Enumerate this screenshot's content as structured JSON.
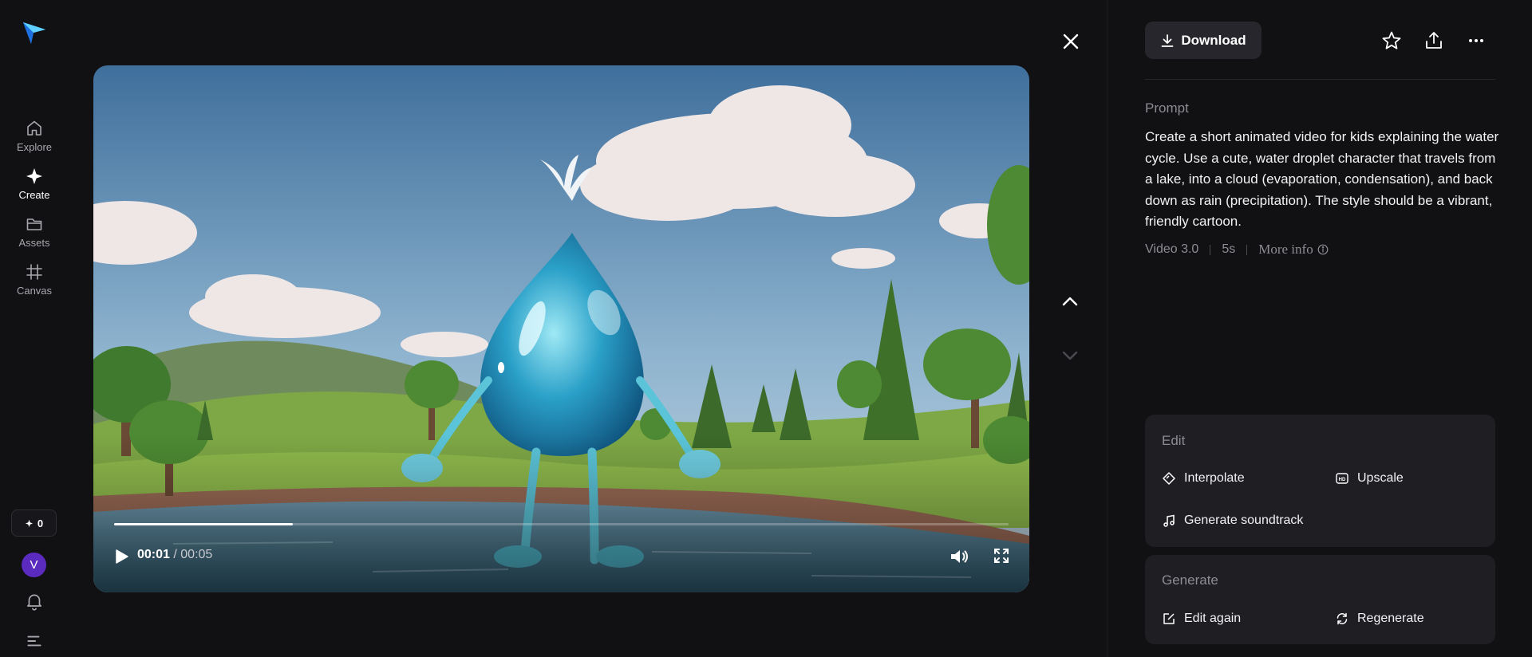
{
  "nav": {
    "items": [
      {
        "label": "Explore",
        "icon": "home-icon"
      },
      {
        "label": "Create",
        "icon": "sparkle-icon",
        "active": true
      },
      {
        "label": "Assets",
        "icon": "folder-icon"
      },
      {
        "label": "Canvas",
        "icon": "canvas-icon"
      }
    ],
    "credits": "0",
    "avatar_initial": "V"
  },
  "player": {
    "current_time": "00:01",
    "duration": "/ 00:05",
    "progress": 0.2
  },
  "header": {
    "download_label": "Download"
  },
  "prompt": {
    "title": "Prompt",
    "text": "Create a short animated video for kids explaining the water cycle. Use a cute, water droplet character that travels from a lake, into a cloud (evaporation, condensation), and back down as rain (precipitation). The style should be a vibrant, friendly cartoon.",
    "model": "Video 3.0",
    "length": "5s",
    "more_info": "More info"
  },
  "edit": {
    "title": "Edit",
    "interpolate": "Interpolate",
    "upscale": "Upscale",
    "soundtrack": "Generate soundtrack"
  },
  "generate": {
    "title": "Generate",
    "edit_again": "Edit again",
    "regenerate": "Regenerate"
  },
  "colors": {
    "background": "#111114",
    "panel_card": "#1e1e23",
    "avatar": "#5b2bbf",
    "accent_blue": "#2aa8ff"
  }
}
